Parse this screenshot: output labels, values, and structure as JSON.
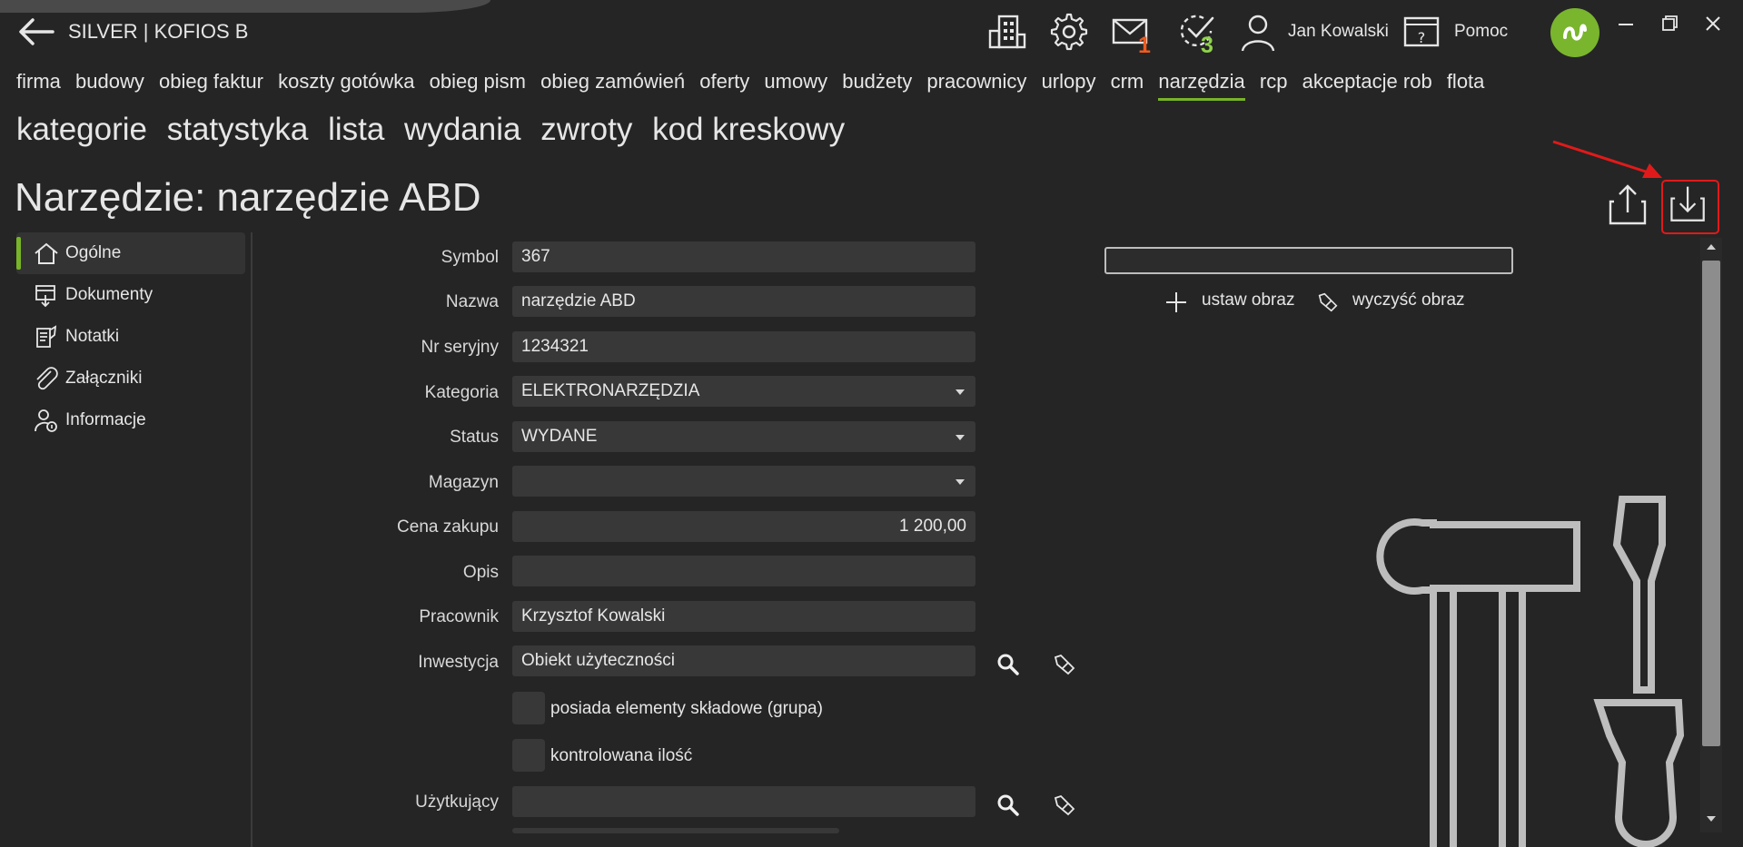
{
  "app": {
    "title": "SILVER | KOFIOS B"
  },
  "topbar": {
    "mail_count": "1",
    "tasks_count": "3",
    "user_name": "Jan Kowalski",
    "help_label": "Pomoc",
    "mail_badge_color": "#f05a1e",
    "tasks_badge_color": "#8fd34a"
  },
  "main_nav": [
    {
      "label": "firma"
    },
    {
      "label": "budowy"
    },
    {
      "label": "obieg faktur"
    },
    {
      "label": "koszty gotówka"
    },
    {
      "label": "obieg pism"
    },
    {
      "label": "obieg zamówień"
    },
    {
      "label": "oferty"
    },
    {
      "label": "umowy"
    },
    {
      "label": "budżety"
    },
    {
      "label": "pracownicy"
    },
    {
      "label": "urlopy"
    },
    {
      "label": "crm"
    },
    {
      "label": "narzędzia"
    },
    {
      "label": "rcp"
    },
    {
      "label": "akceptacje rob"
    },
    {
      "label": "flota"
    }
  ],
  "sub_nav": [
    {
      "label": "kategorie"
    },
    {
      "label": "statystyka"
    },
    {
      "label": "lista"
    },
    {
      "label": "wydania"
    },
    {
      "label": "zwroty"
    },
    {
      "label": "kod kreskowy"
    }
  ],
  "page": {
    "title": "Narzędzie: narzędzie ABD"
  },
  "sidebar": [
    {
      "label": "Ogólne",
      "icon": "home-icon"
    },
    {
      "label": "Dokumenty",
      "icon": "documents-icon"
    },
    {
      "label": "Notatki",
      "icon": "notes-icon"
    },
    {
      "label": "Załączniki",
      "icon": "paperclip-icon"
    },
    {
      "label": "Informacje",
      "icon": "user-info-icon"
    }
  ],
  "form": {
    "symbol": {
      "label": "Symbol",
      "value": "367"
    },
    "nazwa": {
      "label": "Nazwa",
      "value": "narzędzie ABD"
    },
    "nr_seryjny": {
      "label": "Nr seryjny",
      "value": "1234321"
    },
    "kategoria": {
      "label": "Kategoria",
      "value": "ELEKTRONARZĘDZIA"
    },
    "status": {
      "label": "Status",
      "value": "WYDANE"
    },
    "magazyn": {
      "label": "Magazyn",
      "value": ""
    },
    "cena_zakupu": {
      "label": "Cena zakupu",
      "value": "1 200,00"
    },
    "opis": {
      "label": "Opis",
      "value": ""
    },
    "pracownik": {
      "label": "Pracownik",
      "value": "Krzysztof Kowalski"
    },
    "inwestycja": {
      "label": "Inwestycja",
      "value": "Obiekt użyteczności"
    },
    "grupa_checkbox": {
      "label": "posiada elementy składowe (grupa)"
    },
    "ilosc_checkbox": {
      "label": "kontrolowana ilość"
    },
    "uzytkujacy": {
      "label": "Użytkujący",
      "value": ""
    }
  },
  "image_panel": {
    "set_label": "ustaw obraz",
    "clear_label": "wyczyść obraz"
  },
  "colors": {
    "accent": "#78b428",
    "highlight": "#e01a1a",
    "background": "#252525"
  }
}
